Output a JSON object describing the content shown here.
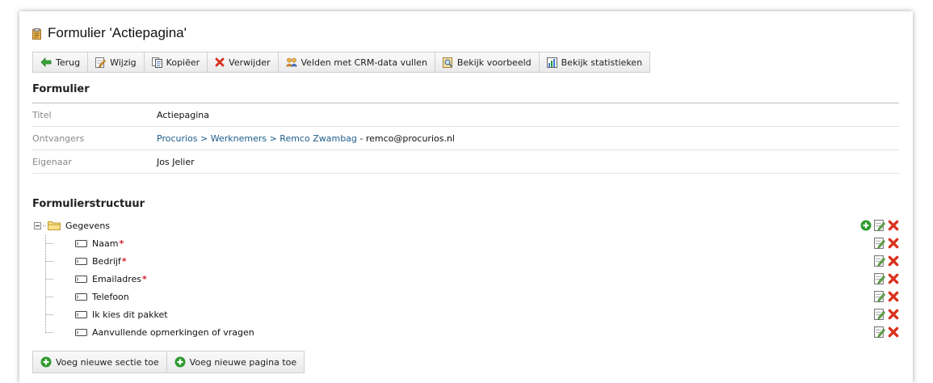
{
  "page": {
    "title": "Formulier 'Actiepagina'"
  },
  "toolbar": [
    {
      "label": "Terug",
      "icon": "back-arrow-icon"
    },
    {
      "label": "Wijzig",
      "icon": "edit-icon"
    },
    {
      "label": "Kopiëer",
      "icon": "copy-icon"
    },
    {
      "label": "Verwijder",
      "icon": "delete-icon"
    },
    {
      "label": "Velden met CRM-data vullen",
      "icon": "users-icon"
    },
    {
      "label": "Bekijk voorbeeld",
      "icon": "preview-icon"
    },
    {
      "label": "Bekijk statistieken",
      "icon": "stats-icon"
    }
  ],
  "form_section": {
    "heading": "Formulier",
    "rows": [
      {
        "label": "Titel",
        "value": "Actiepagina"
      },
      {
        "label": "Ontvangers",
        "link": "Procurios > Werknemers > Remco Zwambag",
        "suffix": " - remco@procurios.nl"
      },
      {
        "label": "Eigenaar",
        "value": "Jos Jelier"
      }
    ]
  },
  "structure": {
    "heading": "Formulierstructuur",
    "folder": "Gegevens",
    "fields": [
      {
        "label": "Naam",
        "required": "*"
      },
      {
        "label": "Bedrijf",
        "required": "*"
      },
      {
        "label": "Emailadres",
        "required": "*"
      },
      {
        "label": "Telefoon",
        "required": ""
      },
      {
        "label": "Ik kies dit pakket",
        "required": ""
      },
      {
        "label": "Aanvullende opmerkingen of vragen",
        "required": ""
      }
    ]
  },
  "bottom_buttons": [
    {
      "label": "Voeg nieuwe sectie toe",
      "icon": "add-icon"
    },
    {
      "label": "Voeg nieuwe pagina toe",
      "icon": "add-icon"
    }
  ],
  "colors": {
    "link": "#1d5c8a",
    "required": "#d0202a",
    "delete": "#d9301c",
    "add": "#2e9a2e"
  }
}
